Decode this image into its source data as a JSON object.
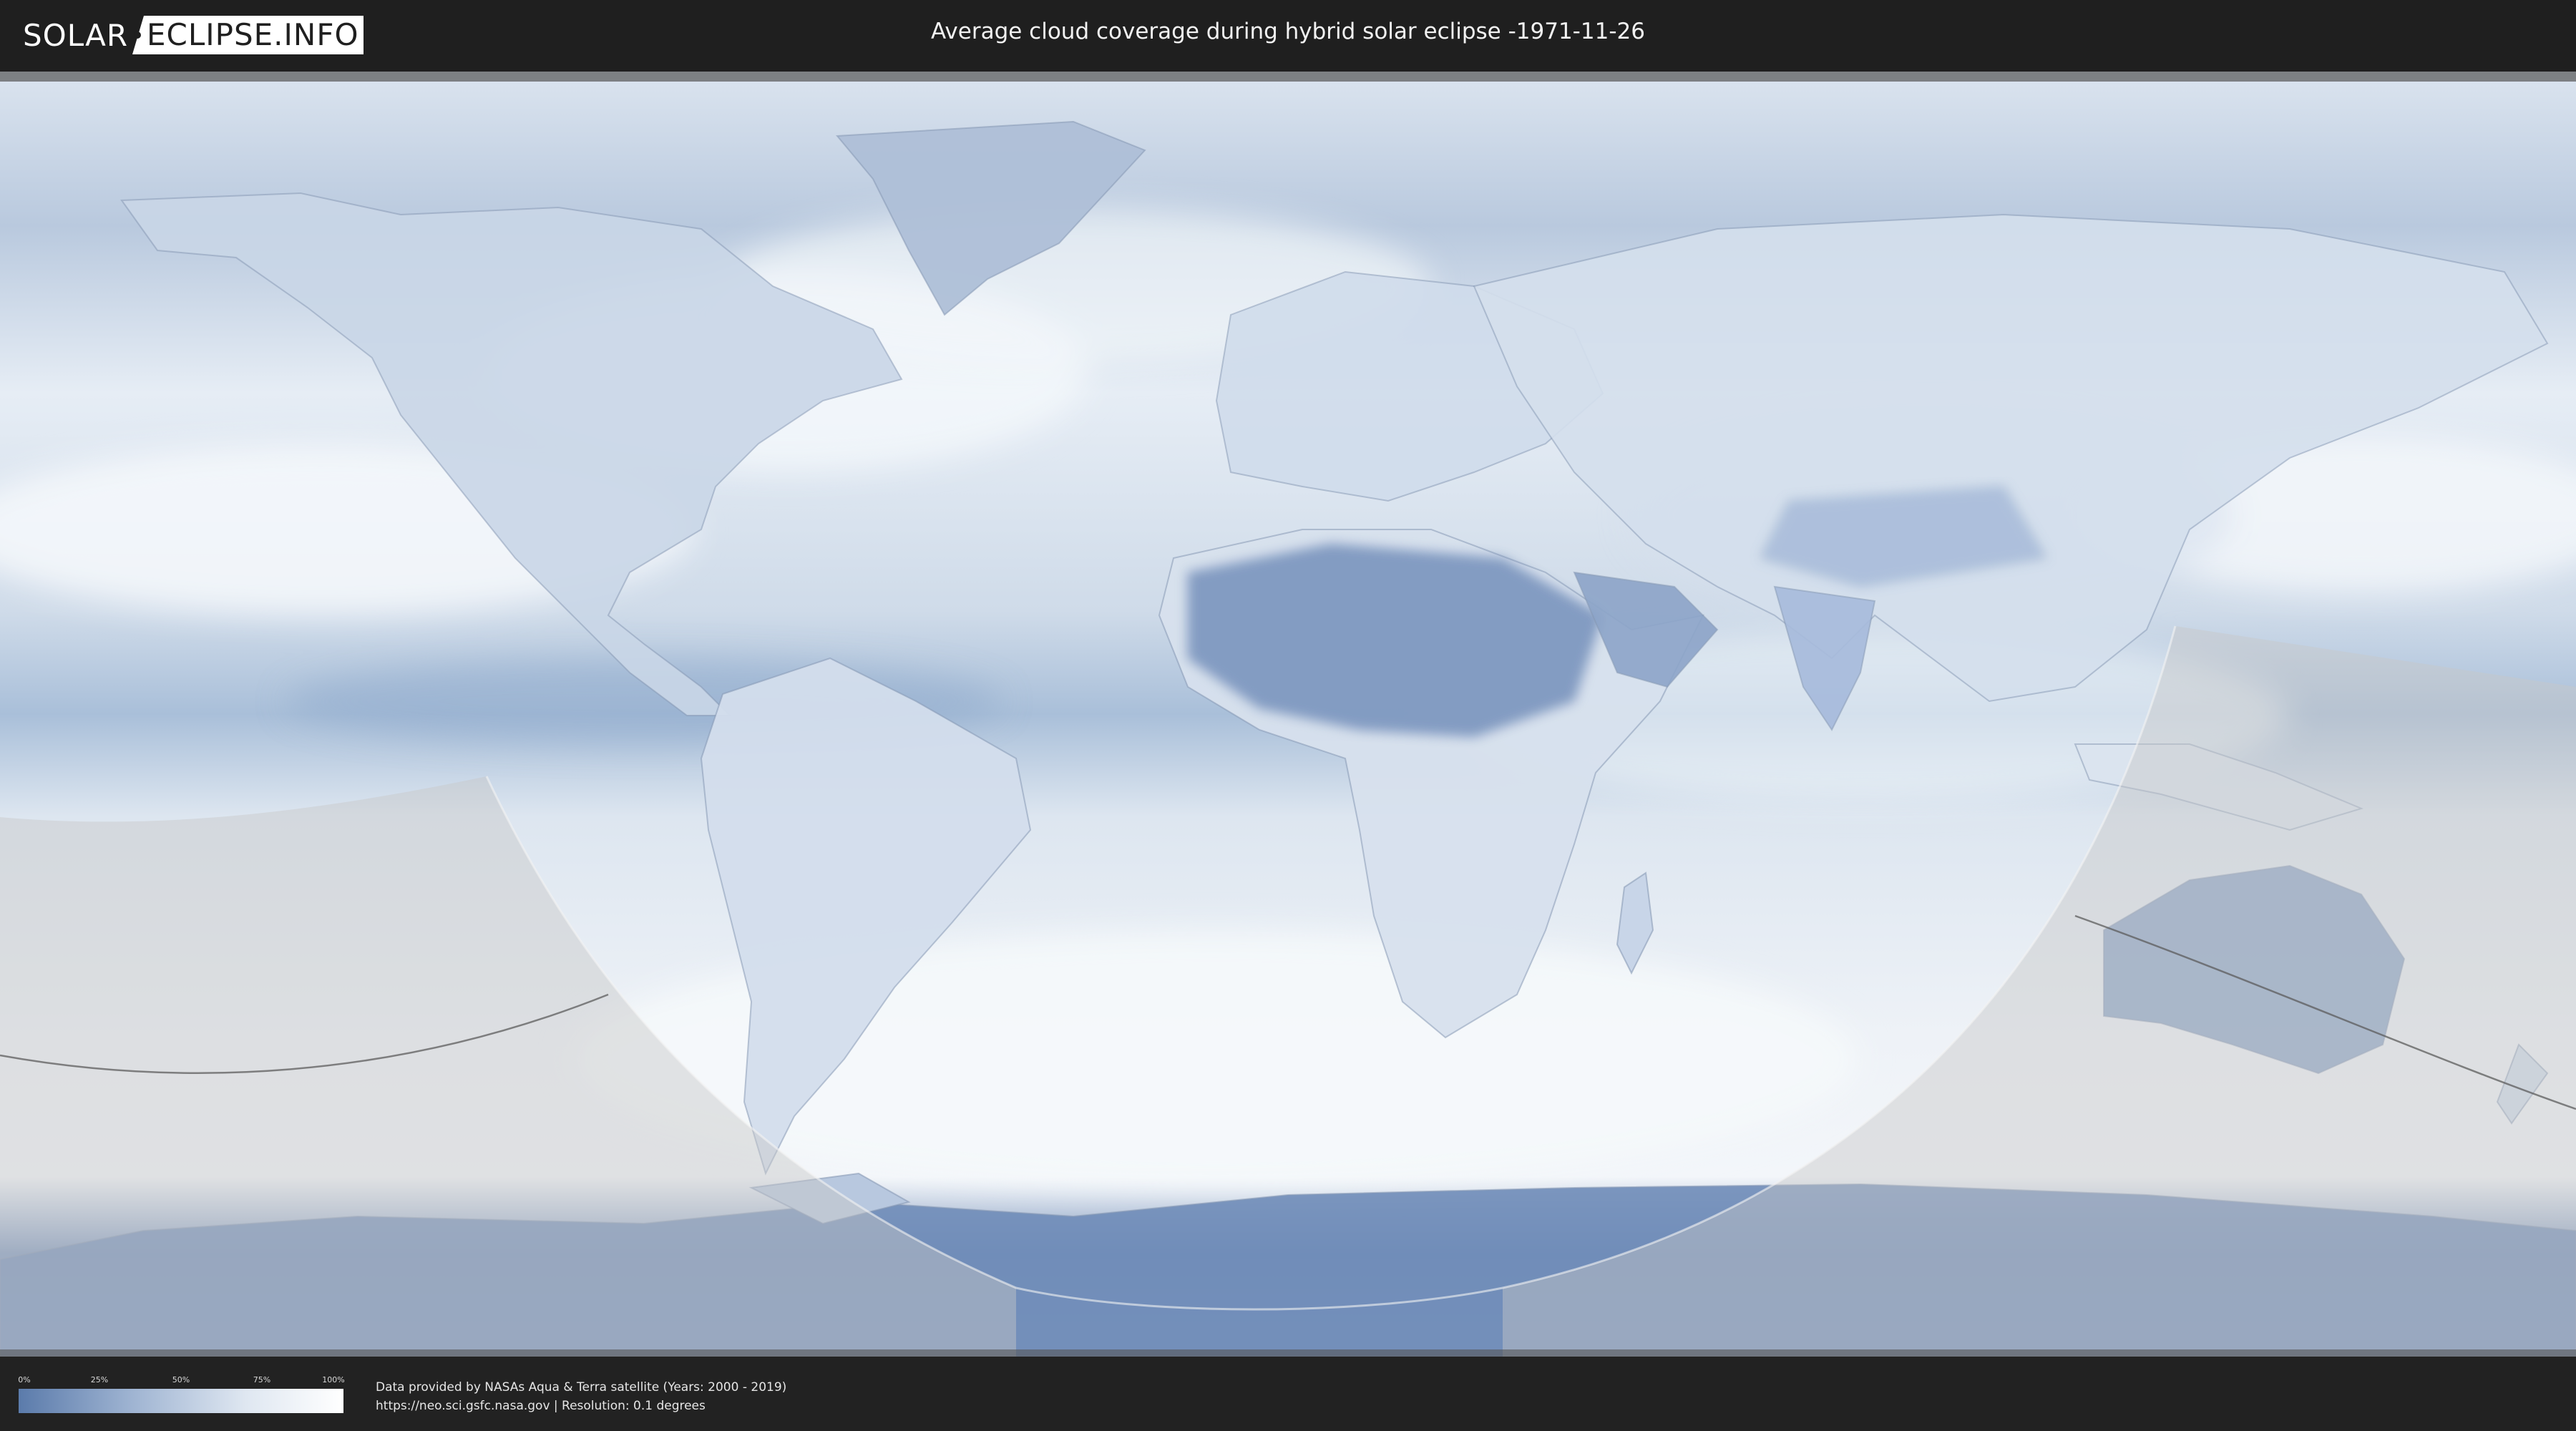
{
  "header": {
    "logo_left": "SOLAR",
    "logo_right": "ECLIPSE.INFO",
    "title": "Average cloud coverage during hybrid solar eclipse -1971-11-26"
  },
  "legend": {
    "ticks": [
      "0%",
      "25%",
      "50%",
      "75%",
      "100%"
    ],
    "colors": {
      "low": "#5b7bab",
      "high": "#ffffff"
    }
  },
  "credits": {
    "line1": "Data provided by NASAs Aqua & Terra satellite (Years: 2000 - 2019)",
    "line2": "https://neo.sci.gsfc.nasa.gov | Resolution: 0.1 degrees"
  },
  "map": {
    "projection": "equirectangular",
    "colors": {
      "clear_sky": "#6f8db8",
      "cloudy": "#f4f7fb",
      "eclipse_shade": "#c9c9c9",
      "coastline": "#7d8fa8",
      "eclipse_path": "#555555"
    }
  }
}
